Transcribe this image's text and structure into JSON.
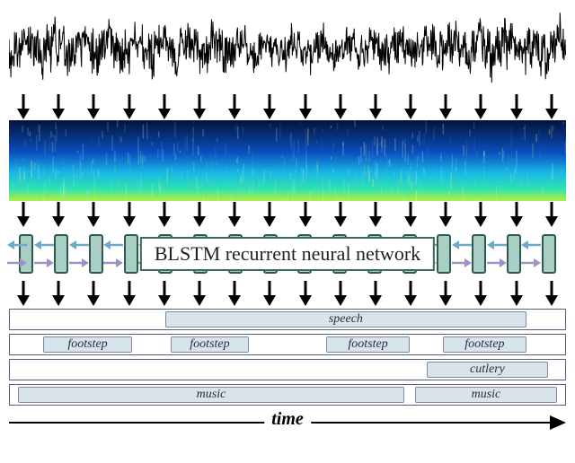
{
  "blstm_label": "BLSTM recurrent neural network",
  "time_label": "time",
  "num_columns": 16,
  "track_labels": {
    "speech": "speech",
    "footstep": "footstep",
    "cutlery": "cutlery",
    "music": "music"
  },
  "tracks": [
    {
      "segments": [
        {
          "start": 0.28,
          "end": 0.93,
          "label_key": "speech"
        }
      ]
    },
    {
      "segments": [
        {
          "start": 0.06,
          "end": 0.22,
          "label_key": "footstep"
        },
        {
          "start": 0.29,
          "end": 0.43,
          "label_key": "footstep"
        },
        {
          "start": 0.57,
          "end": 0.72,
          "label_key": "footstep"
        },
        {
          "start": 0.78,
          "end": 0.93,
          "label_key": "footstep"
        }
      ]
    },
    {
      "segments": [
        {
          "start": 0.75,
          "end": 0.97,
          "label_key": "cutlery"
        }
      ]
    },
    {
      "segments": [
        {
          "start": 0.015,
          "end": 0.71,
          "label_key": "music"
        },
        {
          "start": 0.73,
          "end": 0.985,
          "label_key": "music"
        }
      ]
    }
  ],
  "colors": {
    "cell_fill": "#a9cfc4",
    "cell_border": "#2e5b4f",
    "seg_fill": "#d9e4ea",
    "seg_border": "#7a8aa0",
    "fwd_arrow": "#6fa9c9",
    "back_arrow": "#a091c4"
  }
}
